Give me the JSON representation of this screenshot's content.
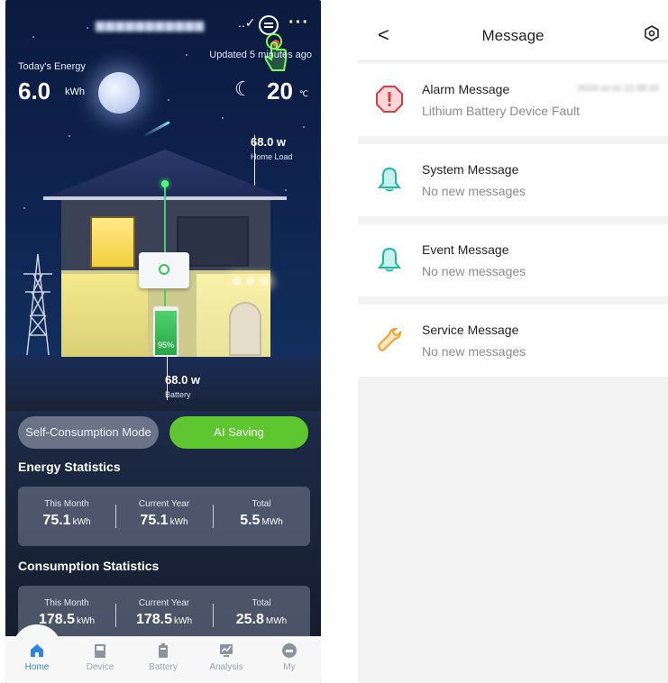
{
  "home_screen": {
    "header": {
      "site_name": "▆▆▆▆▆▆▆▆▆▆▆",
      "site_chevron": "..✓",
      "more": "···",
      "updated": "Updated 5 minutes ago"
    },
    "today_energy": {
      "label": "Today's Energy",
      "value": "6.0",
      "unit": "kWh"
    },
    "weather": {
      "icon": "moon-icon",
      "temperature": "20",
      "unit": "℃"
    },
    "home_load": {
      "value": "68.0 w",
      "label": "Home Load"
    },
    "battery": {
      "value": "68.0 w",
      "label": "Battery",
      "percent": "95%",
      "fill_fraction": 0.95
    },
    "modes": {
      "self_consumption": "Self-Consumption Mode",
      "ai_saving": "AI Saving"
    },
    "energy_statistics": {
      "title": "Energy Statistics",
      "cells": [
        {
          "label": "This Month",
          "value": "75.1",
          "unit": "kWh"
        },
        {
          "label": "Current Year",
          "value": "75.1",
          "unit": "kWh"
        },
        {
          "label": "Total",
          "value": "5.5",
          "unit": "MWh"
        }
      ]
    },
    "consumption_statistics": {
      "title": "Consumption Statistics",
      "cells": [
        {
          "label": "This Month",
          "value": "178.5",
          "unit": "kWh"
        },
        {
          "label": "Current Year",
          "value": "178.5",
          "unit": "kWh"
        },
        {
          "label": "Total",
          "value": "25.8",
          "unit": "MWh"
        }
      ]
    },
    "nav": [
      {
        "label": "Home",
        "icon": "home-icon",
        "active": true
      },
      {
        "label": "Device",
        "icon": "device-icon",
        "active": false
      },
      {
        "label": "Battery",
        "icon": "battery-icon",
        "active": false
      },
      {
        "label": "Analysis",
        "icon": "analysis-icon",
        "active": false
      },
      {
        "label": "My",
        "icon": "user-icon",
        "active": false
      }
    ],
    "colors": {
      "accent_green": "#5ec62f",
      "nav_active": "#2e86de"
    }
  },
  "message_screen": {
    "title": "Message",
    "back": "<",
    "messages": [
      {
        "name": "Alarm Message",
        "sub": "Lithium Battery Device Fault",
        "time": "2024-xx-xx 21:09:10",
        "icon": "alarm-icon",
        "color": "#e0393e"
      },
      {
        "name": "System Message",
        "sub": "No new messages",
        "icon": "bell-icon",
        "color": "#1bb8a6"
      },
      {
        "name": "Event Message",
        "sub": "No new messages",
        "icon": "bell-icon",
        "color": "#1bb8a6"
      },
      {
        "name": "Service Message",
        "sub": "No new messages",
        "icon": "wrench-icon",
        "color": "#f0a030"
      }
    ]
  }
}
